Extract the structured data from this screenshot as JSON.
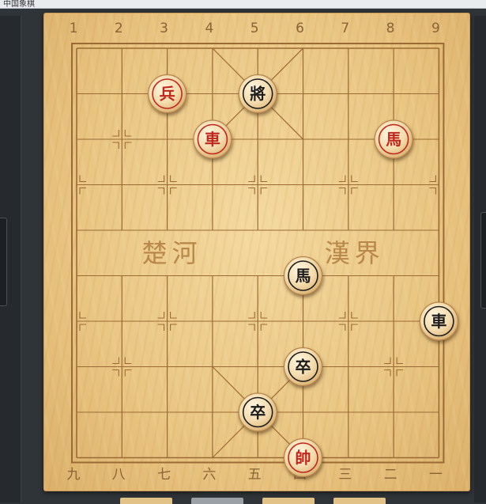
{
  "window": {
    "title": "中国象棋"
  },
  "board": {
    "top_labels": [
      "1",
      "2",
      "3",
      "4",
      "5",
      "6",
      "7",
      "8",
      "9"
    ],
    "bottom_labels": [
      "九",
      "八",
      "七",
      "六",
      "五",
      "四",
      "三",
      "二",
      "一"
    ],
    "river_left": "楚河",
    "river_right": "漢界"
  },
  "pieces": [
    {
      "id": "red-soldier",
      "text": "兵",
      "side": "red",
      "col": 3,
      "row": 1
    },
    {
      "id": "black-general",
      "text": "將",
      "side": "black",
      "col": 5,
      "row": 1
    },
    {
      "id": "red-chariot-upper",
      "text": "車",
      "side": "red",
      "col": 4,
      "row": 2
    },
    {
      "id": "red-horse",
      "text": "馬",
      "side": "red",
      "col": 8,
      "row": 2
    },
    {
      "id": "black-horse",
      "text": "馬",
      "side": "black",
      "col": 6,
      "row": 5
    },
    {
      "id": "black-chariot",
      "text": "車",
      "side": "black",
      "col": 9,
      "row": 6
    },
    {
      "id": "black-soldier-1",
      "text": "卒",
      "side": "black",
      "col": 6,
      "row": 7
    },
    {
      "id": "black-soldier-2",
      "text": "卒",
      "side": "black",
      "col": 5,
      "row": 8
    },
    {
      "id": "red-general",
      "text": "帥",
      "side": "red",
      "col": 6,
      "row": 9
    }
  ],
  "colors": {
    "red_text": "#c0271b",
    "black_text": "#1c1c1c",
    "grid": "#9c6a34",
    "board": "#ecc98a"
  }
}
